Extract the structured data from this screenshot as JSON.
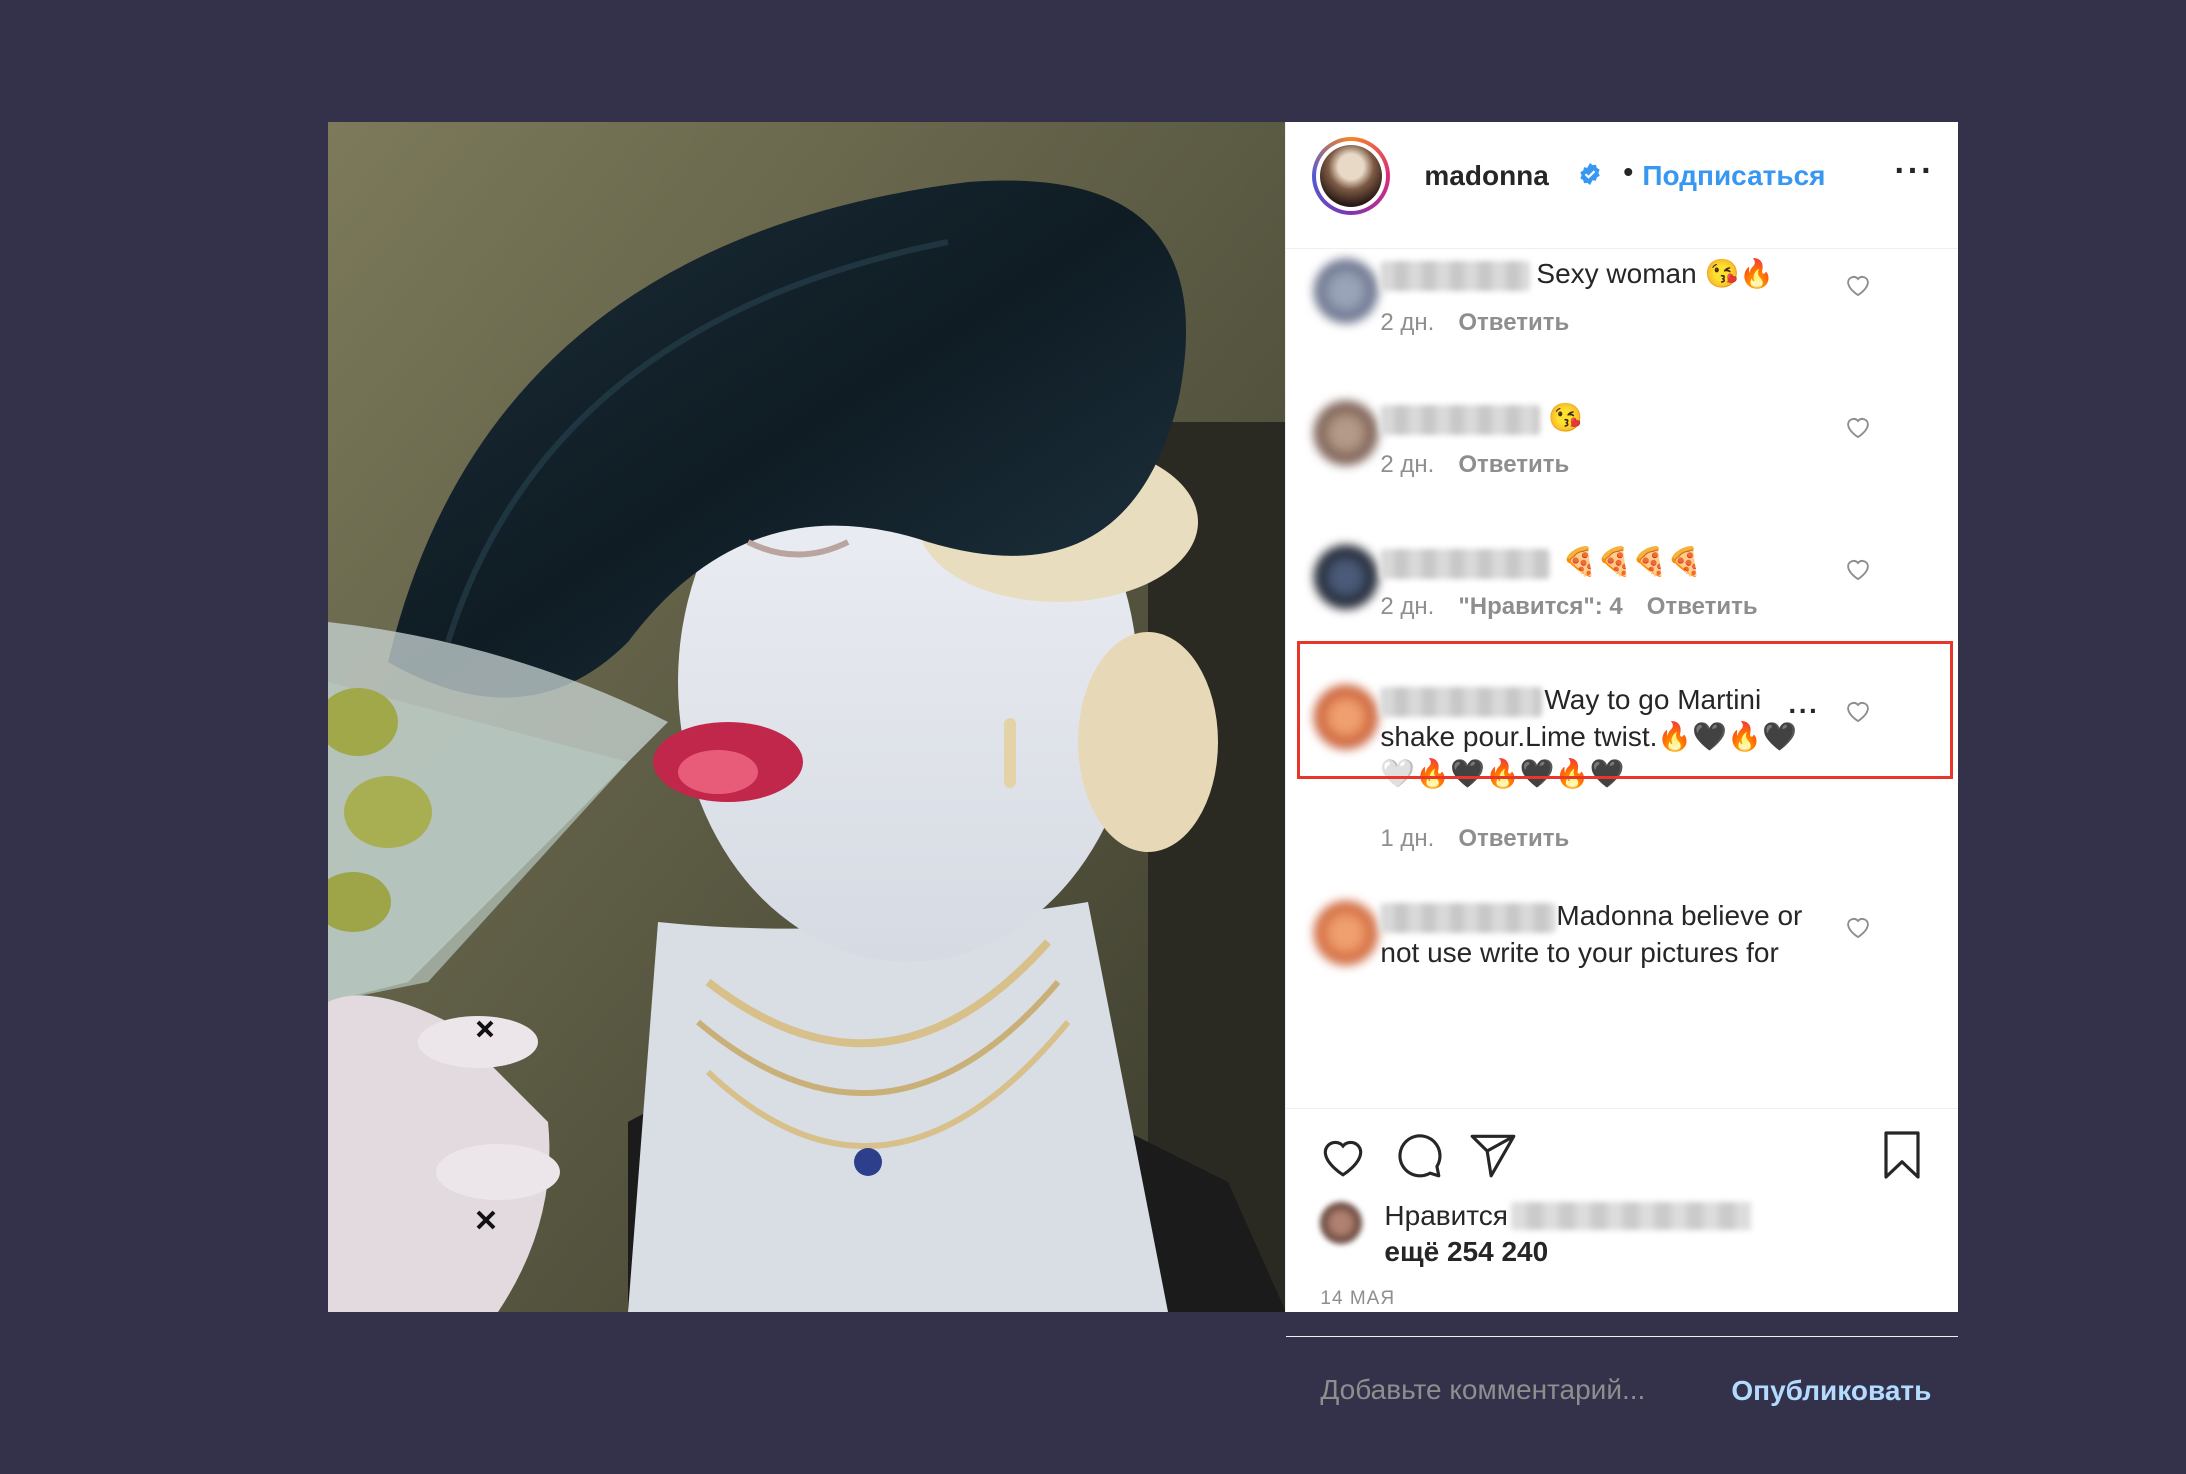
{
  "post": {
    "author": {
      "username": "madonna",
      "verified": true,
      "separator": "•",
      "follow_label": "Подписаться"
    },
    "more_icon": "more-horizontal-icon",
    "comments": [
      {
        "text": "Sexy woman 😘🔥",
        "time": "2 дн.",
        "likes_label": "",
        "reply_label": "Ответить"
      },
      {
        "text": "😘",
        "time": "2 дн.",
        "likes_label": "",
        "reply_label": "Ответить"
      },
      {
        "text": "🍕🍕🍕🍕",
        "time": "2 дн.",
        "likes_label": "\"Нравится\": 4",
        "reply_label": "Ответить",
        "highlighted": true
      },
      {
        "text": "Way to go Martini shake pour.Lime twist.🔥🖤🔥🖤🤍🔥🖤🔥🖤🔥🖤",
        "time": "1 дн.",
        "likes_label": "",
        "reply_label": "Ответить"
      },
      {
        "text": "Madonna believe or not use write to your pictures for",
        "time": "",
        "likes_label": "",
        "reply_label": ""
      }
    ],
    "actions": {
      "like_icon": "heart-icon",
      "comment_icon": "comment-icon",
      "share_icon": "send-icon",
      "save_icon": "bookmark-icon"
    },
    "likes": {
      "prefix": "Нравится",
      "count_line": "ещё 254 240"
    },
    "date": "14 МАЯ",
    "add_comment": {
      "placeholder": "Добавьте комментарий...",
      "publish_label": "Опубликовать"
    },
    "colors": {
      "background": "#34324b",
      "link": "#3897f0",
      "publish_disabled": "#b3dbff",
      "highlight": "#e8372a"
    }
  }
}
